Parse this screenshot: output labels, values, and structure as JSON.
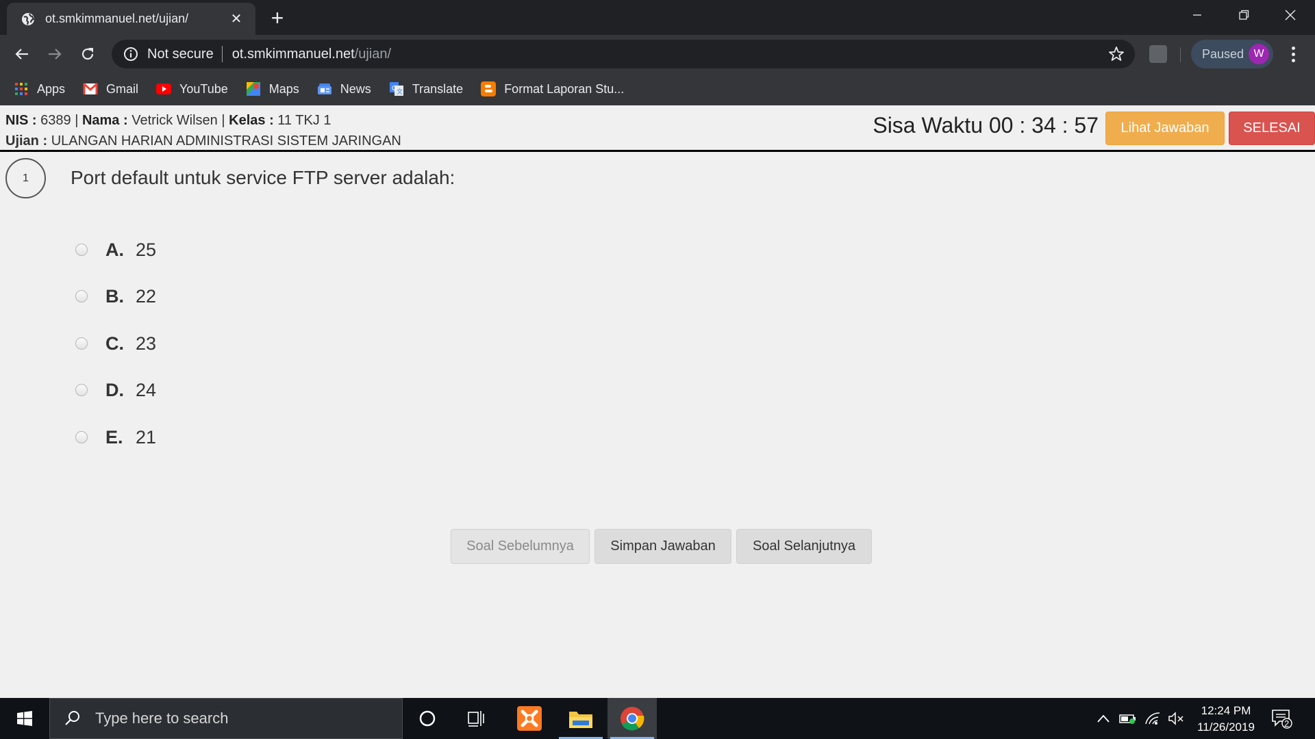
{
  "browser": {
    "tab_title": "ot.smkimmanuel.net/ujian/",
    "security_label": "Not secure",
    "url_host": "ot.smkimmanuel.net",
    "url_path": "/ujian/",
    "profile_status": "Paused",
    "profile_initial": "W",
    "bookmarks": [
      {
        "label": "Apps",
        "icon": "apps-grid-icon"
      },
      {
        "label": "Gmail",
        "icon": "gmail-icon"
      },
      {
        "label": "YouTube",
        "icon": "youtube-icon"
      },
      {
        "label": "Maps",
        "icon": "maps-icon"
      },
      {
        "label": "News",
        "icon": "news-icon"
      },
      {
        "label": "Translate",
        "icon": "translate-icon"
      },
      {
        "label": "Format Laporan Stu...",
        "icon": "blogger-icon"
      }
    ]
  },
  "exam": {
    "nis_label": "NIS :",
    "nis_value": "6389",
    "nama_label": "Nama :",
    "nama_value": "Vetrick Wilsen",
    "kelas_label": "Kelas :",
    "kelas_value": "11 TKJ 1",
    "ujian_label": "Ujian :",
    "ujian_value": "ULANGAN HARIAN ADMINISTRASI SISTEM JARINGAN",
    "separator": "|",
    "timer_label": "Sisa Waktu",
    "timer_value": "00 : 34 : 57",
    "lihat_jawaban": "Lihat Jawaban",
    "selesai": "SELESAI"
  },
  "question": {
    "number": "1",
    "text": "Port default untuk service FTP server adalah:",
    "options": [
      {
        "letter": "A.",
        "value": "25"
      },
      {
        "letter": "B.",
        "value": "22"
      },
      {
        "letter": "C.",
        "value": "23"
      },
      {
        "letter": "D.",
        "value": "24"
      },
      {
        "letter": "E.",
        "value": "21"
      }
    ]
  },
  "pagination": {
    "prev": "Soal Sebelumnya",
    "save": "Simpan Jawaban",
    "next": "Soal Selanjutnya"
  },
  "taskbar": {
    "search_placeholder": "Type here to search",
    "time": "12:24 PM",
    "date": "11/26/2019",
    "notification_count": "2"
  },
  "colors": {
    "warning": "#f0ad4e",
    "danger": "#d9534f",
    "chrome_dark": "#35363a",
    "tab_strip": "#202124",
    "avatar": "#9c27b0"
  }
}
